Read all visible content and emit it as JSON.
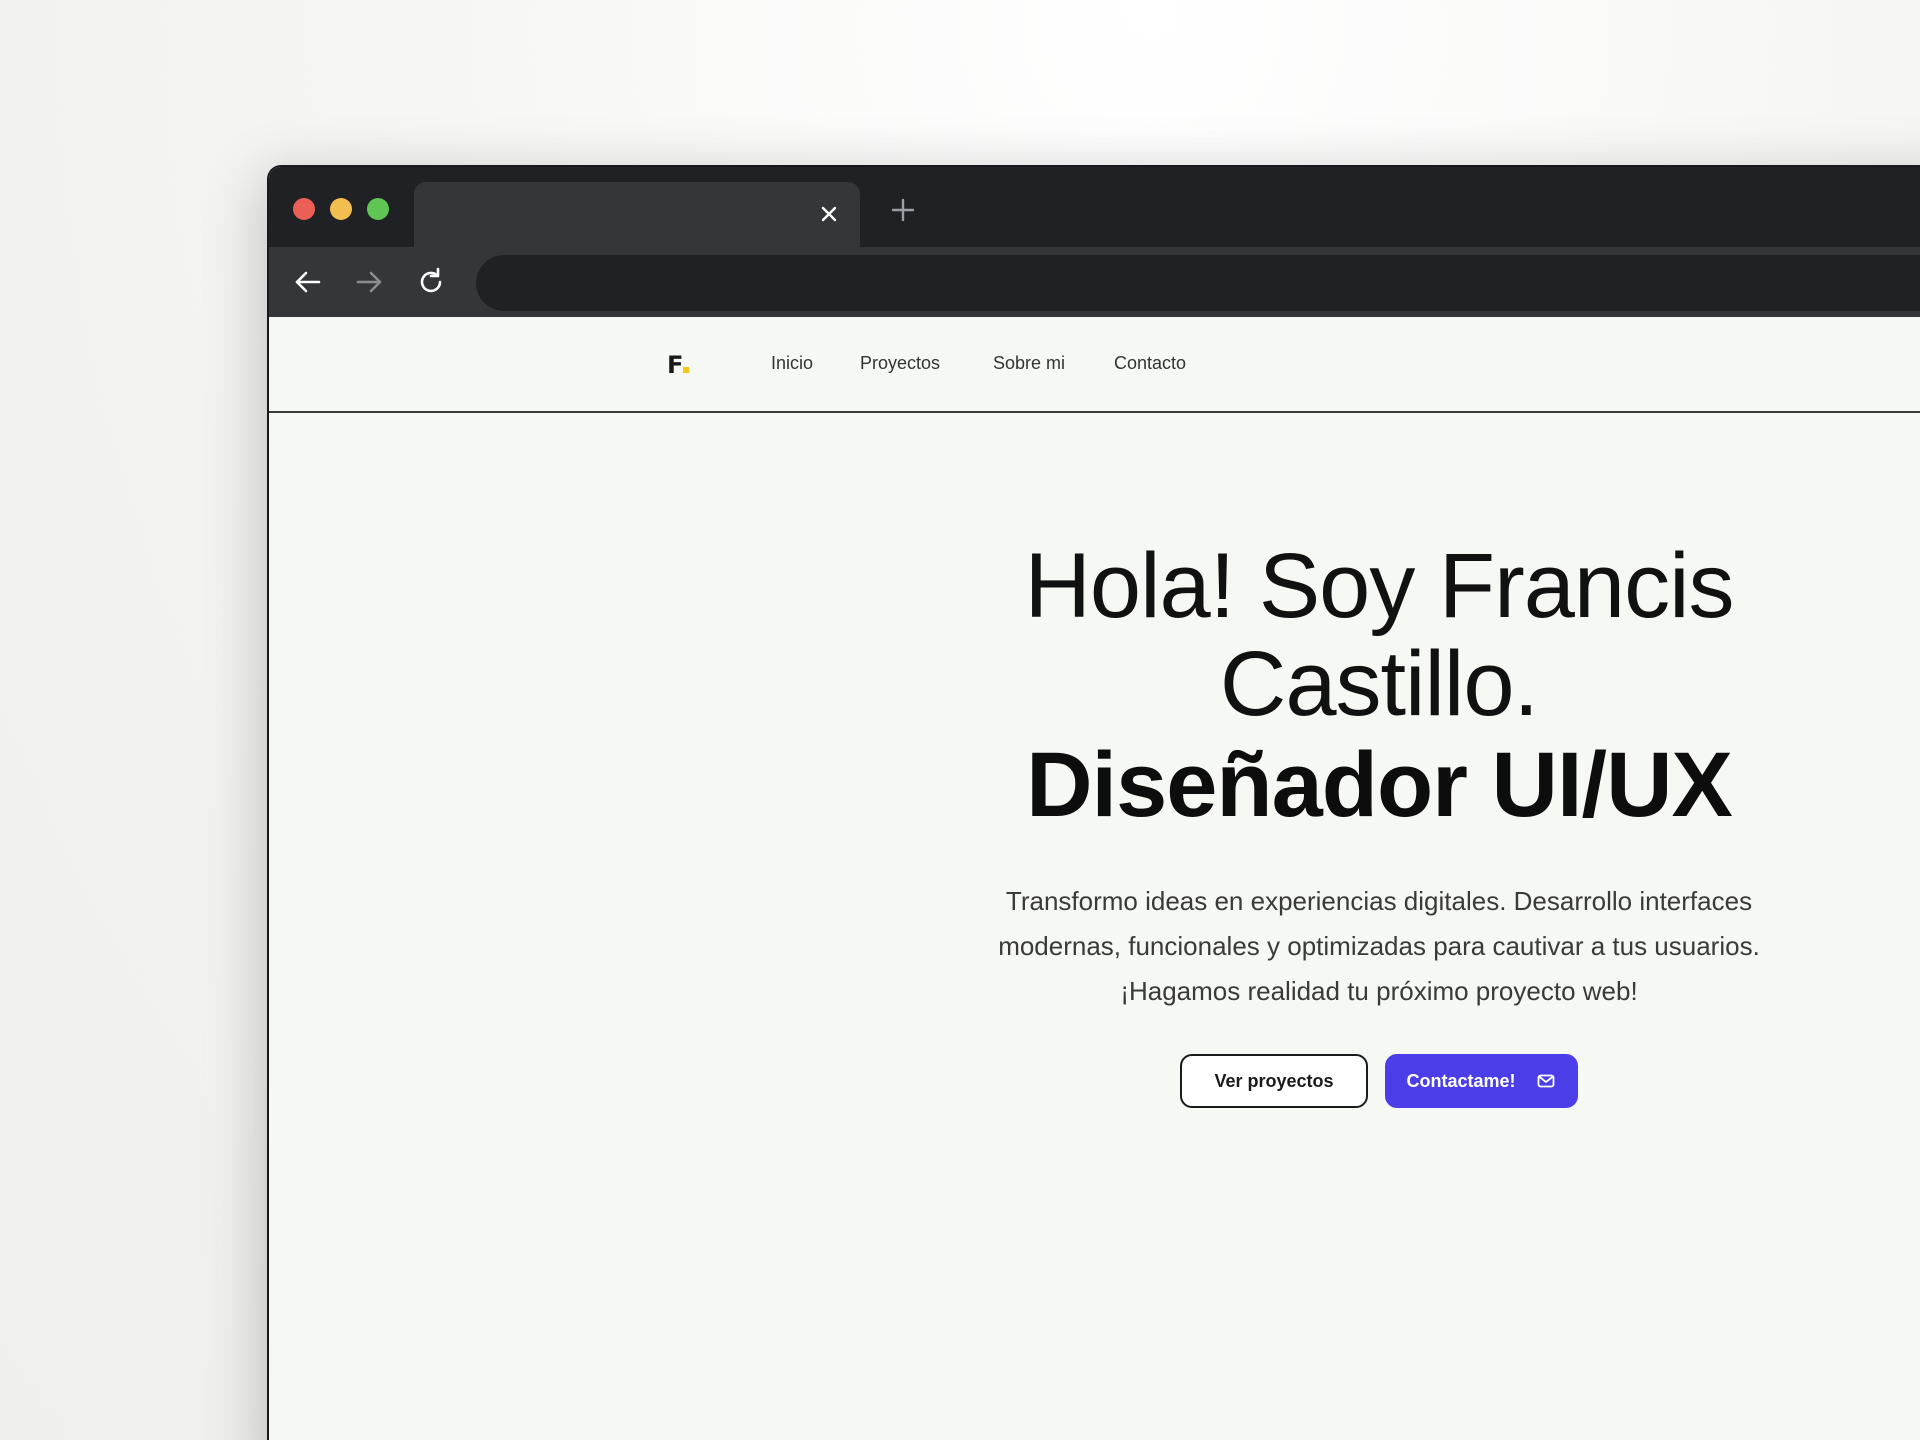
{
  "browser": {
    "tab_title": "",
    "url": "",
    "icons": {
      "close": "close-icon",
      "new_tab": "plus-icon",
      "back": "arrow-left-icon",
      "forward": "arrow-right-icon",
      "reload": "reload-icon"
    }
  },
  "site": {
    "logo": "F",
    "nav": {
      "items": [
        {
          "label": "Inicio"
        },
        {
          "label": "Proyectos"
        },
        {
          "label": "Sobre mi"
        },
        {
          "label": "Contacto"
        }
      ]
    },
    "hero": {
      "line1a": "Hola! Soy Francis",
      "line1b": "Castillo.",
      "line2": "Diseñador UI/UX",
      "description": "Transformo ideas en experiencias digitales. Desarrollo interfaces modernas, funcionales y optimizadas para cautivar a tus usuarios. ¡Hagamos realidad tu próximo proyecto web!",
      "btn_projects": "Ver proyectos",
      "btn_contact": "Contactame!",
      "contact_icon": "mail-icon"
    }
  },
  "colors": {
    "accent": "#4b3ee8",
    "logo_dot": "#f5c518",
    "page_bg": "#f6f8f4",
    "chrome_dark": "#202124",
    "chrome_mid": "#35363a"
  }
}
